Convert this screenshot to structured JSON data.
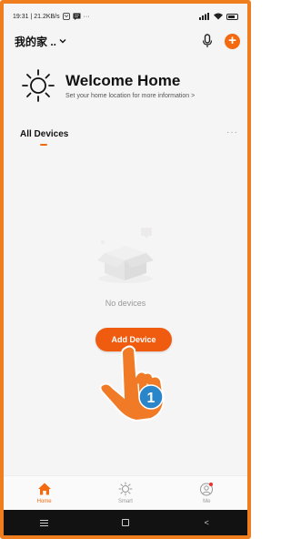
{
  "status_bar": {
    "left_text": "19:31 | 21.2KB/s",
    "left_icons": [
      "timer-icon",
      "message-icon",
      "more-icon"
    ],
    "right_icons": [
      "signal-icon",
      "wifi-icon",
      "battery-icon"
    ]
  },
  "header": {
    "home_name": "我的家 ..",
    "dropdown_icon": "chevron-down-icon",
    "mic_icon": "microphone-icon",
    "add_label": "+"
  },
  "welcome": {
    "title": "Welcome Home",
    "subtitle": "Set your home location for more information >"
  },
  "rooms": {
    "active_tab": "All Devices",
    "more_label": "···"
  },
  "empty_state": {
    "message": "No devices",
    "button_label": "Add Device"
  },
  "annotation": {
    "step_number": "1",
    "pointer_icon": "hand-pointer-icon"
  },
  "tab_bar": {
    "items": [
      {
        "label": "Home",
        "icon": "home-icon",
        "active": true
      },
      {
        "label": "Smart",
        "icon": "sun-icon",
        "active": false
      },
      {
        "label": "Me",
        "icon": "profile-icon",
        "active": false
      }
    ]
  },
  "nav_bar": {
    "back_label": "<"
  },
  "colors": {
    "accent": "#f36a10",
    "frame": "#f07d1e",
    "background": "#f6f5f5"
  }
}
